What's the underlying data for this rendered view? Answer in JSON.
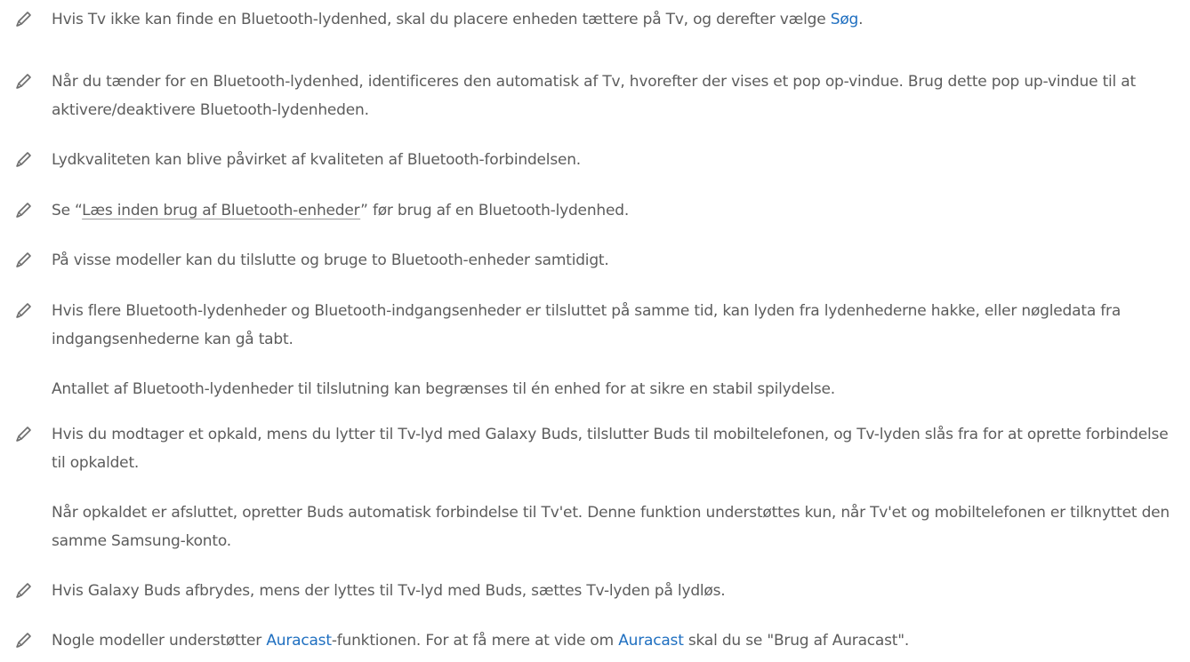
{
  "notes": [
    {
      "pre": "Hvis Tv ikke kan finde en Bluetooth-lydenhed, skal du placere enheden tættere på Tv, og derefter vælge ",
      "link": "Søg",
      "post": "."
    },
    {
      "text": "Når du tænder for en Bluetooth-lydenhed, identificeres den automatisk af Tv, hvorefter der vises et pop op-vindue. Brug dette pop up-vindue til at aktivere/deaktivere Bluetooth-lydenheden."
    },
    {
      "text": "Lydkvaliteten kan blive påvirket af kvaliteten af Bluetooth-forbindelsen."
    },
    {
      "pre": "Se “",
      "link": "Læs inden brug af Bluetooth-enheder",
      "post": "” før brug af en Bluetooth-lydenhed."
    },
    {
      "text": "På visse modeller kan du tilslutte og bruge to Bluetooth-enheder samtidigt."
    },
    {
      "text": "Hvis flere Bluetooth-lydenheder og Bluetooth-indgangsenheder er tilsluttet på samme tid, kan lyden fra lydenhederne hakke, eller nøgledata fra indgangsenhederne kan gå tabt.",
      "sub": "Antallet af Bluetooth-lydenheder til tilslutning kan begrænses til én enhed for at sikre en stabil spilydelse."
    },
    {
      "text": "Hvis du modtager et opkald, mens du lytter til Tv-lyd med Galaxy Buds, tilslutter Buds til mobiltelefonen, og Tv-lyden slås fra for at oprette forbindelse til opkaldet.",
      "sub": "Når opkaldet er afsluttet, opretter Buds automatisk forbindelse til Tv'et. Denne funktion understøttes kun, når Tv'et og mobiltelefonen er tilknyttet den samme Samsung-konto."
    },
    {
      "text": "Hvis Galaxy Buds afbrydes, mens der lyttes til Tv-lyd med Buds, sættes Tv-lyden på lydløs."
    },
    {
      "pre": "Nogle modeller understøtter ",
      "link": "Auracast",
      "mid": "-funktionen. For at få mere at vide om ",
      "link2": "Auracast",
      "post": " skal du se \"Brug af Auracast\"."
    }
  ],
  "colors": {
    "text": "#5c5c5c",
    "link": "#1f6fc0",
    "icon": "#6e6e6e"
  },
  "icons": {
    "note": "pencil-icon"
  }
}
